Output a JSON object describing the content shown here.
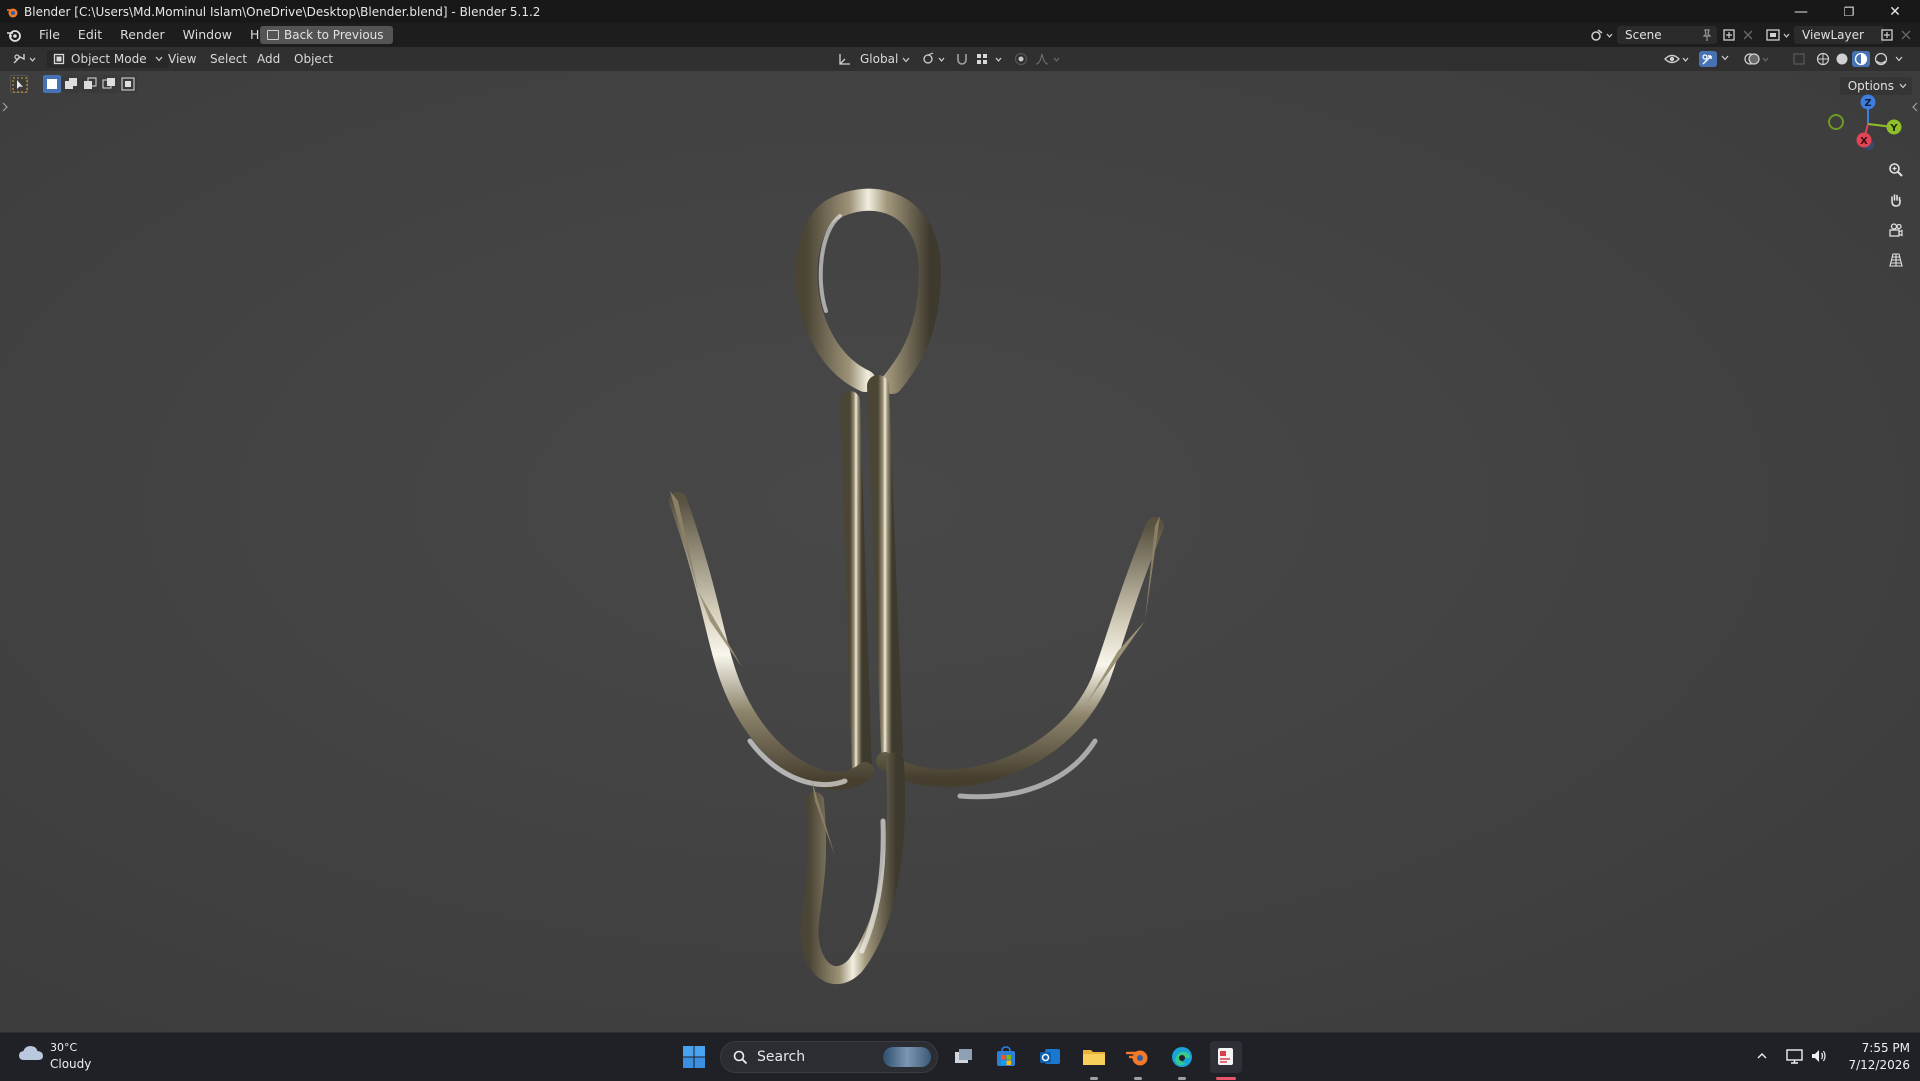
{
  "titlebar": {
    "title": "Blender [C:\\Users\\Md.Mominul Islam\\OneDrive\\Desktop\\Blender.blend] - Blender 5.1.2",
    "minimize": "—",
    "maximize": "❐",
    "close": "✕"
  },
  "menubar": {
    "items": [
      "File",
      "Edit",
      "Render",
      "Window",
      "Help"
    ],
    "back_button": "Back to Previous",
    "scene_name": "Scene",
    "view_layer": "ViewLayer"
  },
  "viewport_header": {
    "mode": "Object Mode",
    "menus": [
      "View",
      "Select",
      "Add",
      "Object"
    ],
    "transform_orientation": "Global"
  },
  "viewport": {
    "options_label": "Options",
    "gizmo_axes": {
      "x": "X",
      "y": "Y",
      "z": "Z"
    },
    "colors": {
      "x_axis": "#e04455",
      "y_axis": "#8fbf2a",
      "z_axis": "#3d7ee0"
    }
  },
  "taskbar": {
    "weather_temp": "30°C",
    "weather_desc": "Cloudy",
    "search_placeholder": "Search",
    "time": "7:55 PM",
    "date": "7/12/2026"
  }
}
